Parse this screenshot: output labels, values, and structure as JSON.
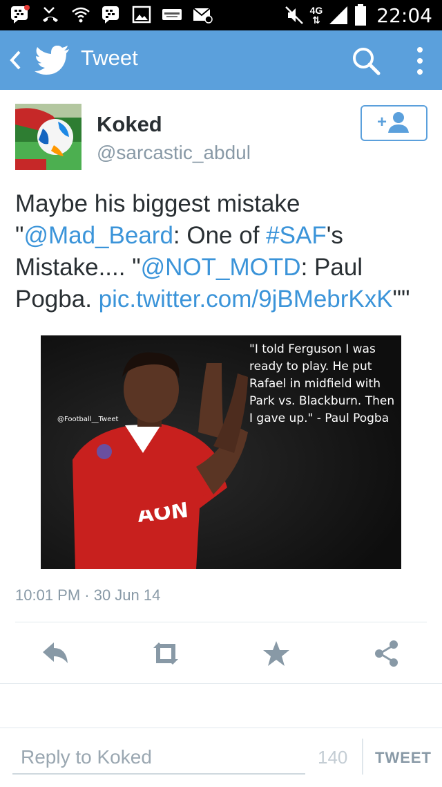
{
  "status_bar": {
    "network": "4G",
    "time": "22:04",
    "icons": [
      "bbm-icon",
      "missed-call-icon",
      "wifi-question-icon",
      "bbm-icon",
      "gallery-icon",
      "eurosport-icon",
      "mail-icon",
      "mute-icon",
      "signal-icon",
      "battery-icon"
    ]
  },
  "app_bar": {
    "title": "Tweet",
    "icons": [
      "back-icon",
      "twitter-bird-icon",
      "search-icon",
      "more-icon"
    ]
  },
  "author": {
    "name": "Koked",
    "handle": "@sarcastic_abdul",
    "follow_icon": "add-user-icon"
  },
  "tweet": {
    "parts": [
      {
        "text": "Maybe his biggest mistake "
      },
      {
        "text": "\""
      },
      {
        "text": "@Mad_Beard",
        "link": true
      },
      {
        "text": ": One of "
      },
      {
        "text": "#SAF",
        "link": true
      },
      {
        "text": "'s Mistake.... \""
      },
      {
        "text": "@NOT_MOTD",
        "link": true
      },
      {
        "text": ": Paul Pogba. "
      },
      {
        "text": "pic.twitter.com/9jBMebrKxK",
        "link": true
      },
      {
        "text": "\"\""
      }
    ],
    "photo": {
      "quote": "\"I told Ferguson I was ready to play. He put Rafael in midfield with Park vs. Blackburn. Then I gave up.\" - Paul Pogba",
      "watermark": "@Football__Tweet",
      "shirt_sponsor": "AON"
    },
    "timestamp": "10:01 PM · 30 Jun 14"
  },
  "actions": [
    "reply-icon",
    "retweet-icon",
    "favorite-icon",
    "share-icon"
  ],
  "reply_bar": {
    "placeholder": "Reply to Koked",
    "char_count": "140",
    "tweet_label": "TWEET"
  },
  "colors": {
    "app_bar": "#5ba0dc",
    "link": "#3b94d9",
    "text": "#292f33",
    "muted": "#8899a6"
  }
}
